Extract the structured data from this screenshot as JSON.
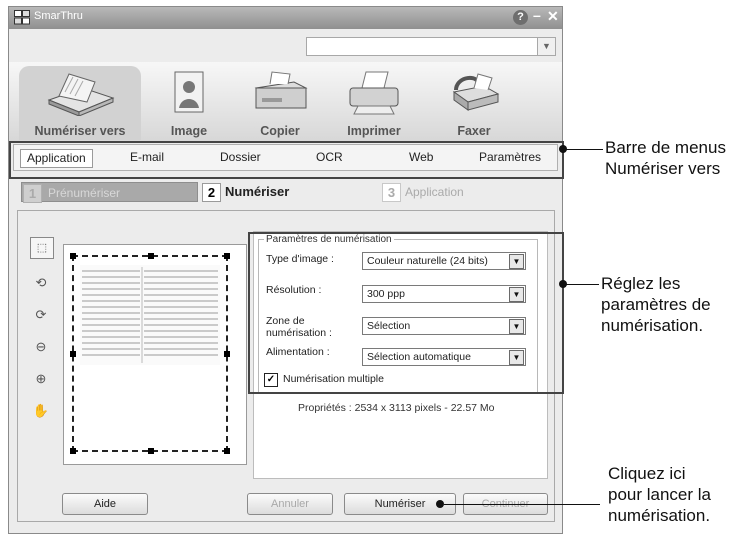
{
  "window": {
    "title": "SmarThru"
  },
  "toolbar": {
    "items": [
      {
        "label": "Numériser vers",
        "icon": "scanner-icon"
      },
      {
        "label": "Image",
        "icon": "image-icon"
      },
      {
        "label": "Copier",
        "icon": "copier-icon"
      },
      {
        "label": "Imprimer",
        "icon": "printer-icon"
      },
      {
        "label": "Faxer",
        "icon": "fax-icon"
      }
    ]
  },
  "menubar": {
    "items": [
      "Application",
      "E-mail",
      "Dossier",
      "OCR",
      "Web",
      "Paramètres"
    ],
    "selected": "Application"
  },
  "steps": [
    {
      "num": "1",
      "label": "Prénumériser"
    },
    {
      "num": "2",
      "label": "Numériser"
    },
    {
      "num": "3",
      "label": "Application"
    }
  ],
  "params": {
    "legend": "Paramètres de numérisation",
    "image_type": {
      "label": "Type d'image :",
      "value": "Couleur naturelle (24 bits)"
    },
    "resolution": {
      "label": "Résolution :",
      "value": "300 ppp"
    },
    "scan_area": {
      "label_line1": "Zone de",
      "label_line2": "numérisation :",
      "value": "Sélection"
    },
    "feed": {
      "label": "Alimentation :",
      "value": "Sélection automatique"
    },
    "multi_scan": {
      "label": "Numérisation multiple",
      "checked": true
    },
    "properties": "Propriétés : 2534 x 3113 pixels - 22.57 Mo"
  },
  "buttons": {
    "help": "Aide",
    "cancel": "Annuler",
    "scan": "Numériser",
    "continue": "Continuer"
  },
  "callouts": {
    "menubar": [
      "Barre de menus",
      "Numériser vers"
    ],
    "params": [
      "Réglez les",
      "paramètres de",
      "numérisation."
    ],
    "scan": [
      "Cliquez ici",
      "pour lancer la",
      "numérisation."
    ]
  }
}
